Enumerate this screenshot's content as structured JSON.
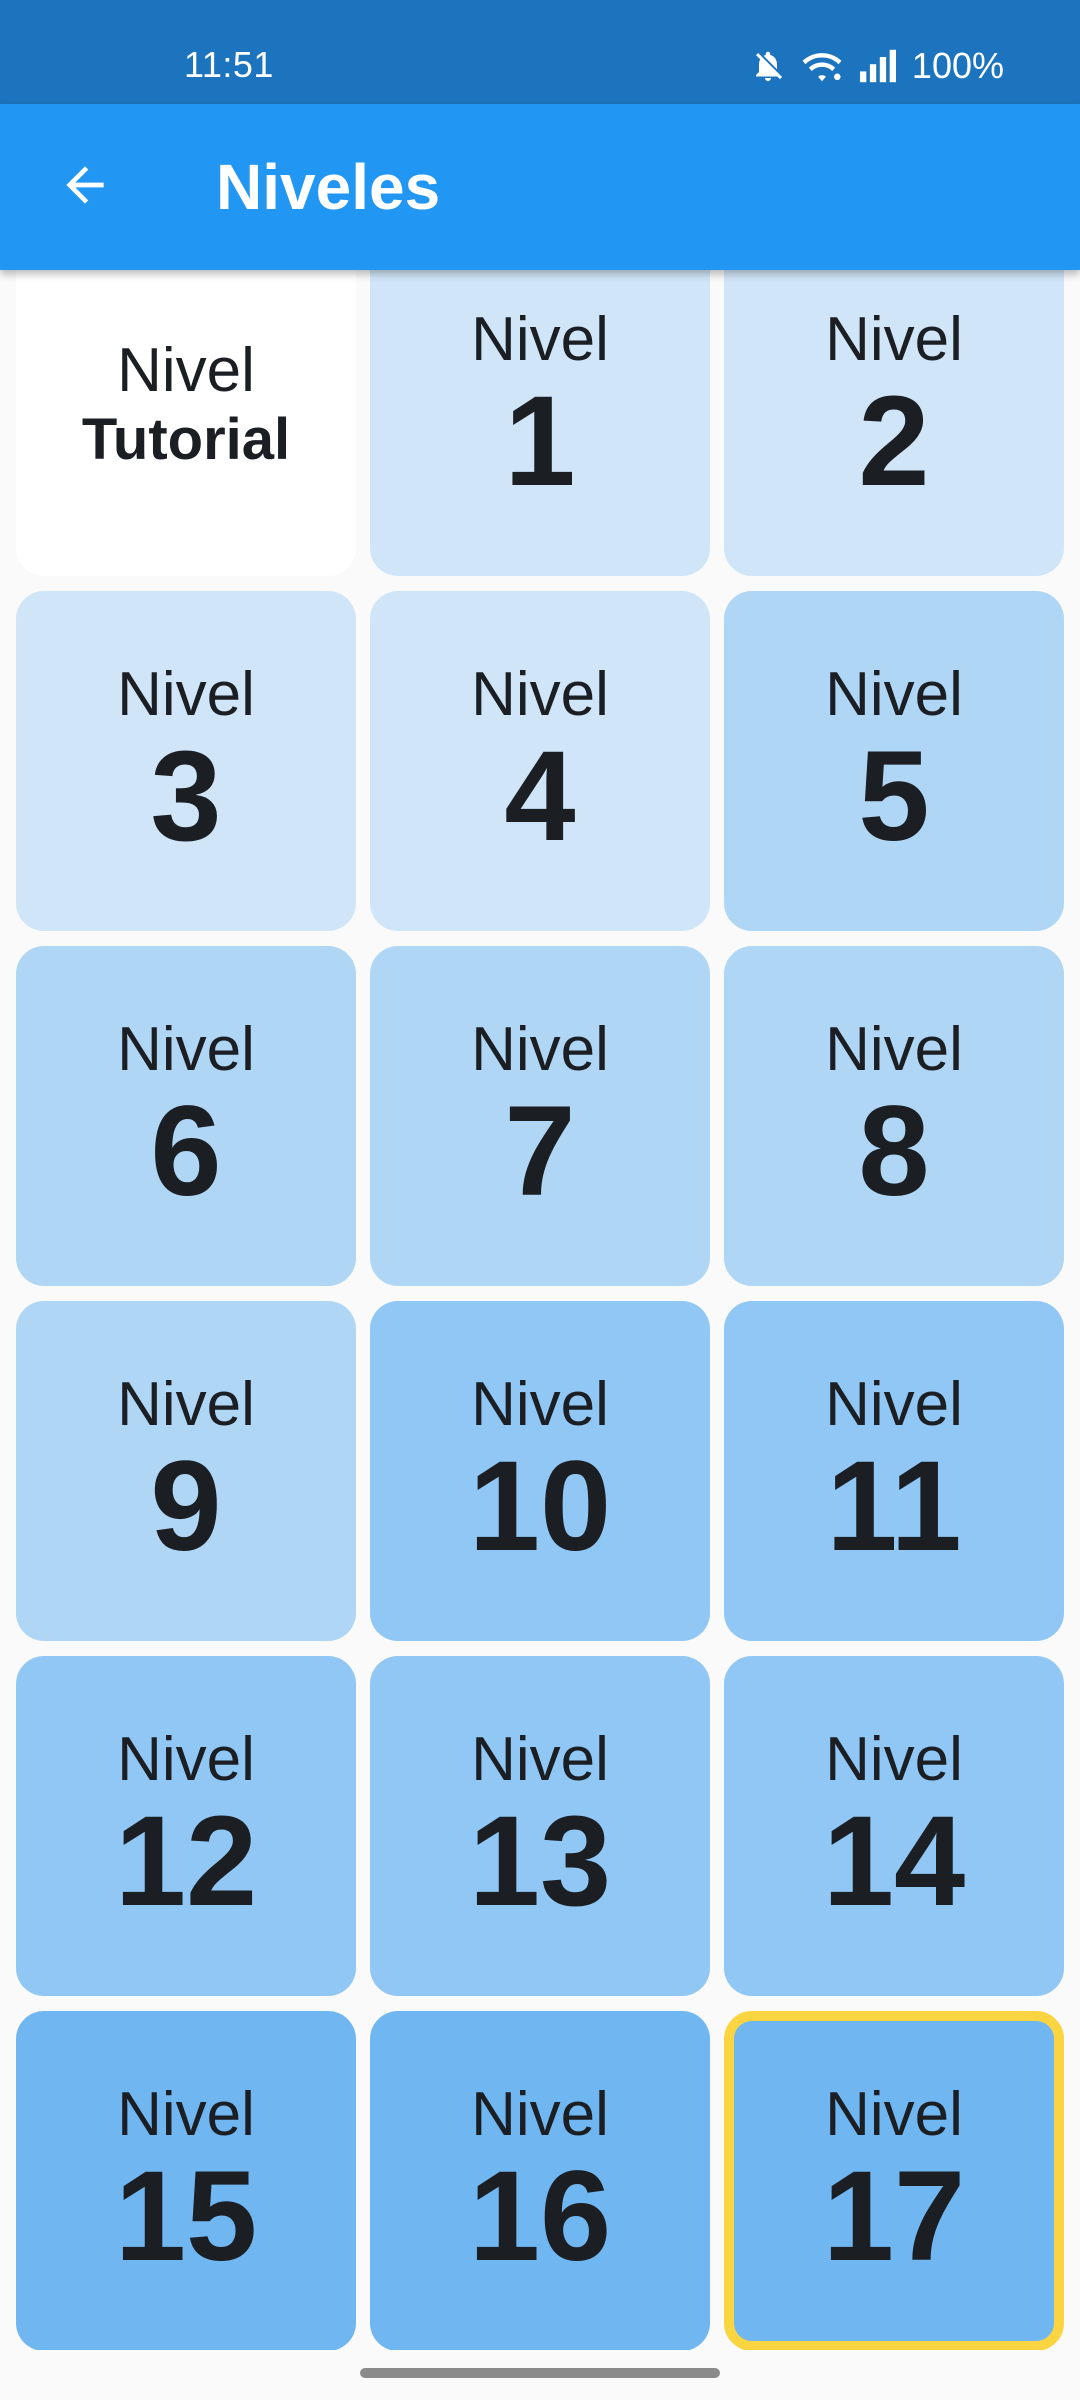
{
  "status_bar": {
    "time": "11:51",
    "battery": "100%",
    "icons": [
      "bell-off-icon",
      "wifi-icon",
      "signal-icon"
    ]
  },
  "app_bar": {
    "title": "Niveles",
    "back_icon": "arrow-left-icon"
  },
  "colors": {
    "status_bar": "#1c74be",
    "app_bar": "#2196f3",
    "tile_white": "#ffffff",
    "tile_light": "#d0e6f8",
    "tile_mid": "#b0d6f6",
    "tile_deep": "#90c7f4",
    "tile_deepest": "#70b7f2",
    "current_border": "#fbd541"
  },
  "levels": [
    {
      "label": "Nivel",
      "number": "Tutorial",
      "shade": "white"
    },
    {
      "label": "Nivel",
      "number": "1",
      "shade": "light"
    },
    {
      "label": "Nivel",
      "number": "2",
      "shade": "light"
    },
    {
      "label": "Nivel",
      "number": "3",
      "shade": "light"
    },
    {
      "label": "Nivel",
      "number": "4",
      "shade": "light"
    },
    {
      "label": "Nivel",
      "number": "5",
      "shade": "mid"
    },
    {
      "label": "Nivel",
      "number": "6",
      "shade": "mid"
    },
    {
      "label": "Nivel",
      "number": "7",
      "shade": "mid"
    },
    {
      "label": "Nivel",
      "number": "8",
      "shade": "mid"
    },
    {
      "label": "Nivel",
      "number": "9",
      "shade": "mid"
    },
    {
      "label": "Nivel",
      "number": "10",
      "shade": "deep"
    },
    {
      "label": "Nivel",
      "number": "11",
      "shade": "deep"
    },
    {
      "label": "Nivel",
      "number": "12",
      "shade": "deep"
    },
    {
      "label": "Nivel",
      "number": "13",
      "shade": "deep"
    },
    {
      "label": "Nivel",
      "number": "14",
      "shade": "deep"
    },
    {
      "label": "Nivel",
      "number": "15",
      "shade": "deepest"
    },
    {
      "label": "Nivel",
      "number": "16",
      "shade": "deepest"
    },
    {
      "label": "Nivel",
      "number": "17",
      "shade": "deepest",
      "current": true
    }
  ]
}
